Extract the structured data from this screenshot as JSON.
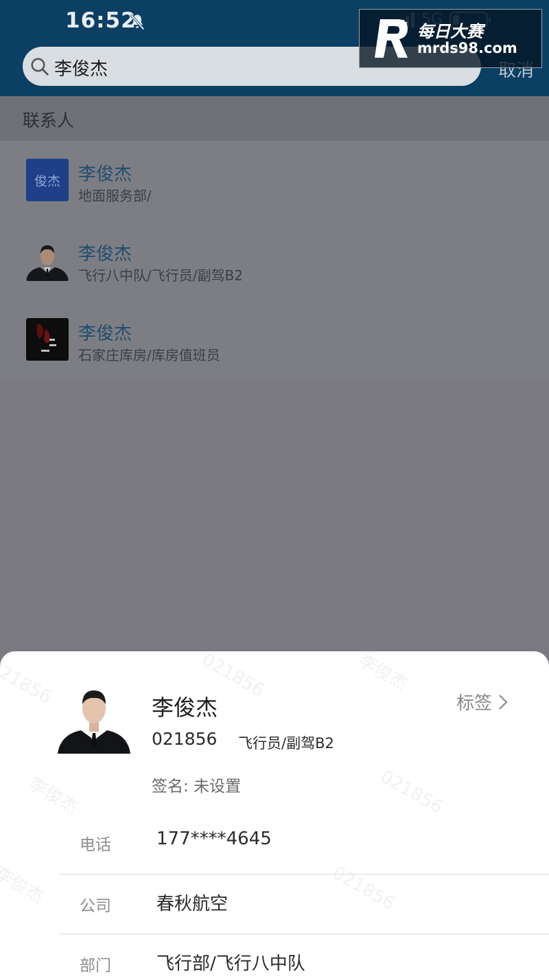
{
  "status_bar": {
    "time": "16:52",
    "network": "5G",
    "battery_percent": 20
  },
  "search": {
    "query": "李俊杰",
    "cancel_label": "取消"
  },
  "watermark": {
    "brand": "每日大赛",
    "url": "mrds98.com"
  },
  "section_title": "联系人",
  "contacts": [
    {
      "name": "李俊杰",
      "subtitle": "地面服务部/",
      "avatar_text": "俊杰"
    },
    {
      "name": "李俊杰",
      "subtitle": "飞行八中队/飞行员/副驾B2"
    },
    {
      "name": "李俊杰",
      "subtitle": "石家庄库房/库房值班员"
    }
  ],
  "profile": {
    "name": "李俊杰",
    "tags_label": "标签",
    "employee_id": "021856",
    "role": "飞行员/副驾B2",
    "signature_label": "签名:",
    "signature_value": "未设置",
    "fields": [
      {
        "label": "电话",
        "value": "177****4645"
      },
      {
        "label": "公司",
        "value": "春秋航空"
      },
      {
        "label": "部门",
        "value": "飞行部/飞行八中队"
      }
    ],
    "watermark_text": [
      "021856",
      "李俊杰"
    ]
  },
  "colors": {
    "header": "#0b3f63",
    "accent_name": "#1f4d6e",
    "sheet_bg": "#ffffff"
  }
}
